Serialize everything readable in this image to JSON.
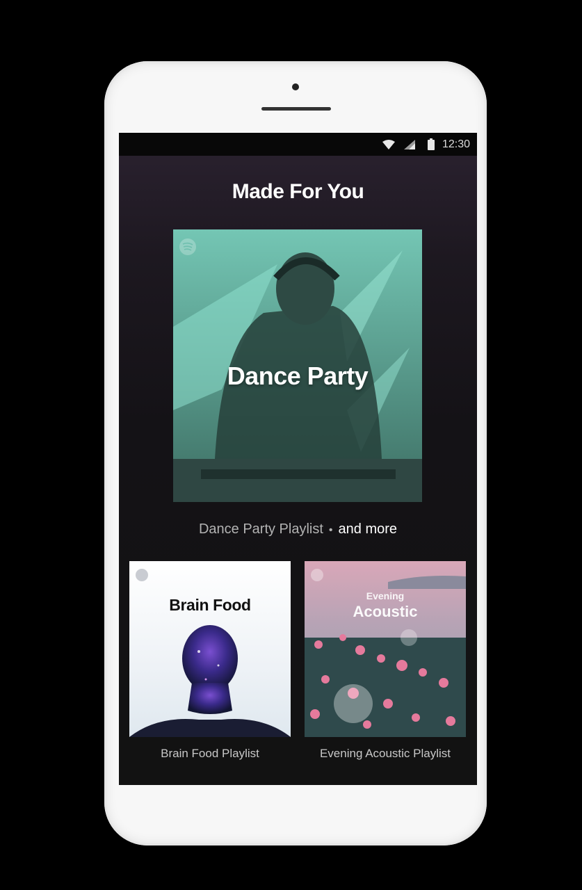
{
  "status_bar": {
    "time": "12:30",
    "icons": [
      "wifi-icon",
      "cellular-signal-icon",
      "battery-icon"
    ]
  },
  "section": {
    "title": "Made For You"
  },
  "featured": {
    "cover_text": "Dance Party",
    "playlist_label": "Dance Party Playlist",
    "separator": "•",
    "more_label": "and more",
    "accent_color": "#6fbfae"
  },
  "cards": [
    {
      "cover_text": "Brain Food",
      "caption": "Brain Food Playlist"
    },
    {
      "cover_text_small": "Evening",
      "cover_text_large": "Acoustic",
      "caption": "Evening Acoustic Playlist"
    }
  ],
  "colors": {
    "background": "#121212",
    "status_bar": "#080808",
    "text_primary": "#ffffff",
    "text_secondary": "#b3b3b3"
  }
}
